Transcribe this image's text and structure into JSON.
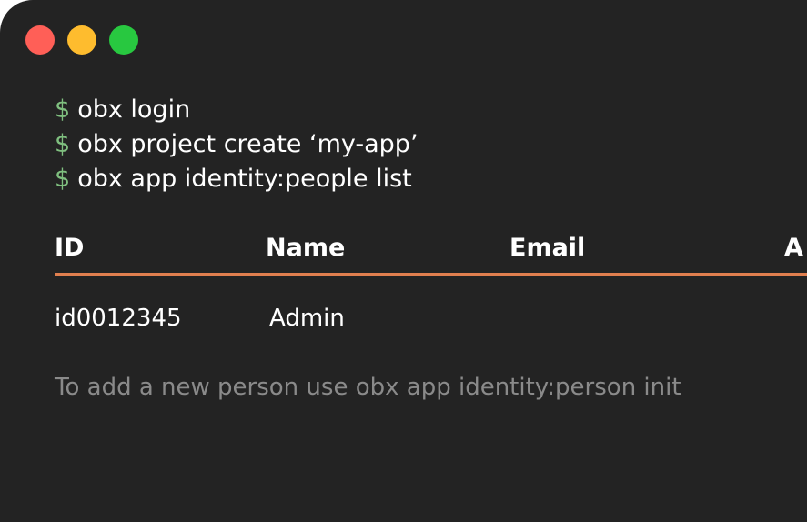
{
  "colors": {
    "background": "#232323",
    "close": "#ff5f57",
    "minimize": "#febc2e",
    "maximize": "#28c840",
    "prompt": "#7fbf7f",
    "accent": "#e07f4f",
    "muted": "#8a8a8a",
    "text": "#ffffff"
  },
  "terminal": {
    "prompt_symbol": "$",
    "commands": [
      "obx login",
      "obx project create ‘my-app’",
      "obx app identity:people list"
    ]
  },
  "table": {
    "headers": [
      "ID",
      "Name",
      "Email",
      "A"
    ],
    "rows": [
      [
        "id0012345",
        "Admin"
      ]
    ]
  },
  "hint": "To add a new person use obx app identity:person init"
}
